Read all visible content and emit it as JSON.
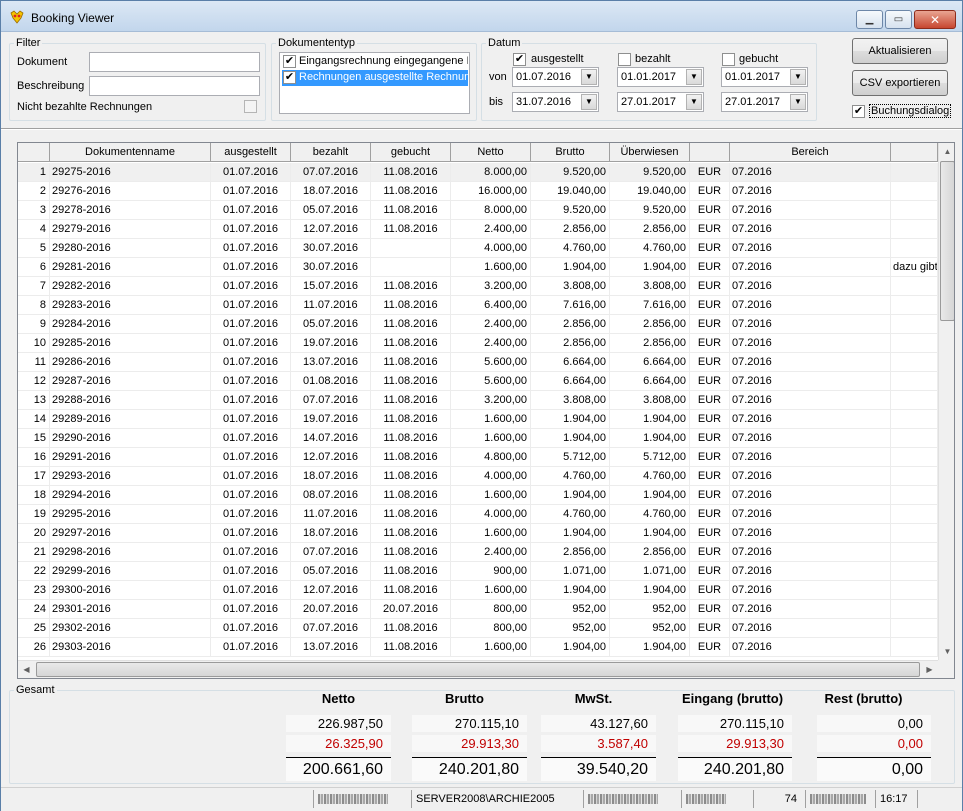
{
  "window": {
    "title": "Booking Viewer"
  },
  "filter": {
    "legend": "Filter",
    "dokument_label": "Dokument",
    "dokument_value": "",
    "beschreibung_label": "Beschreibung",
    "beschreibung_value": "",
    "unpaid_label": "Nicht bezahlte Rechnungen"
  },
  "doctype": {
    "legend": "Dokumententyp",
    "items": [
      {
        "label": "Eingangsrechnung eingegangene Re",
        "checked": true,
        "selected": false
      },
      {
        "label": "Rechnungen ausgestellte Rechnung",
        "checked": true,
        "selected": true
      }
    ]
  },
  "datum": {
    "legend": "Datum",
    "ausgestellt_label": "ausgestellt",
    "bezahlt_label": "bezahlt",
    "gebucht_label": "gebucht",
    "von_label": "von",
    "bis_label": "bis",
    "von": [
      "01.07.2016",
      "01.01.2017",
      "01.01.2017"
    ],
    "bis": [
      "31.07.2016",
      "27.01.2017",
      "27.01.2017"
    ]
  },
  "actions": {
    "aktualisieren": "Aktualisieren",
    "csv": "CSV exportieren",
    "buchungsdialog": "Buchungsdialog"
  },
  "table": {
    "columns": [
      "",
      "Dokumentenname",
      "ausgestellt",
      "bezahlt",
      "gebucht",
      "Netto",
      "Brutto",
      "Überwiesen",
      "",
      "Bereich"
    ],
    "rows": [
      [
        "1",
        "29275-2016",
        "01.07.2016",
        "07.07.2016",
        "11.08.2016",
        "8.000,00",
        "9.520,00",
        "9.520,00",
        "EUR",
        "07.2016",
        ""
      ],
      [
        "2",
        "29276-2016",
        "01.07.2016",
        "18.07.2016",
        "11.08.2016",
        "16.000,00",
        "19.040,00",
        "19.040,00",
        "EUR",
        "07.2016",
        ""
      ],
      [
        "3",
        "29278-2016",
        "01.07.2016",
        "05.07.2016",
        "11.08.2016",
        "8.000,00",
        "9.520,00",
        "9.520,00",
        "EUR",
        "07.2016",
        ""
      ],
      [
        "4",
        "29279-2016",
        "01.07.2016",
        "12.07.2016",
        "11.08.2016",
        "2.400,00",
        "2.856,00",
        "2.856,00",
        "EUR",
        "07.2016",
        ""
      ],
      [
        "5",
        "29280-2016",
        "01.07.2016",
        "30.07.2016",
        "",
        "4.000,00",
        "4.760,00",
        "4.760,00",
        "EUR",
        "07.2016",
        ""
      ],
      [
        "6",
        "29281-2016",
        "01.07.2016",
        "30.07.2016",
        "",
        "1.600,00",
        "1.904,00",
        "1.904,00",
        "EUR",
        "07.2016",
        "dazu gibt"
      ],
      [
        "7",
        "29282-2016",
        "01.07.2016",
        "15.07.2016",
        "11.08.2016",
        "3.200,00",
        "3.808,00",
        "3.808,00",
        "EUR",
        "07.2016",
        ""
      ],
      [
        "8",
        "29283-2016",
        "01.07.2016",
        "11.07.2016",
        "11.08.2016",
        "6.400,00",
        "7.616,00",
        "7.616,00",
        "EUR",
        "07.2016",
        ""
      ],
      [
        "9",
        "29284-2016",
        "01.07.2016",
        "05.07.2016",
        "11.08.2016",
        "2.400,00",
        "2.856,00",
        "2.856,00",
        "EUR",
        "07.2016",
        ""
      ],
      [
        "10",
        "29285-2016",
        "01.07.2016",
        "19.07.2016",
        "11.08.2016",
        "2.400,00",
        "2.856,00",
        "2.856,00",
        "EUR",
        "07.2016",
        ""
      ],
      [
        "11",
        "29286-2016",
        "01.07.2016",
        "13.07.2016",
        "11.08.2016",
        "5.600,00",
        "6.664,00",
        "6.664,00",
        "EUR",
        "07.2016",
        ""
      ],
      [
        "12",
        "29287-2016",
        "01.07.2016",
        "01.08.2016",
        "11.08.2016",
        "5.600,00",
        "6.664,00",
        "6.664,00",
        "EUR",
        "07.2016",
        ""
      ],
      [
        "13",
        "29288-2016",
        "01.07.2016",
        "07.07.2016",
        "11.08.2016",
        "3.200,00",
        "3.808,00",
        "3.808,00",
        "EUR",
        "07.2016",
        ""
      ],
      [
        "14",
        "29289-2016",
        "01.07.2016",
        "19.07.2016",
        "11.08.2016",
        "1.600,00",
        "1.904,00",
        "1.904,00",
        "EUR",
        "07.2016",
        ""
      ],
      [
        "15",
        "29290-2016",
        "01.07.2016",
        "14.07.2016",
        "11.08.2016",
        "1.600,00",
        "1.904,00",
        "1.904,00",
        "EUR",
        "07.2016",
        ""
      ],
      [
        "16",
        "29291-2016",
        "01.07.2016",
        "12.07.2016",
        "11.08.2016",
        "4.800,00",
        "5.712,00",
        "5.712,00",
        "EUR",
        "07.2016",
        ""
      ],
      [
        "17",
        "29293-2016",
        "01.07.2016",
        "18.07.2016",
        "11.08.2016",
        "4.000,00",
        "4.760,00",
        "4.760,00",
        "EUR",
        "07.2016",
        ""
      ],
      [
        "18",
        "29294-2016",
        "01.07.2016",
        "08.07.2016",
        "11.08.2016",
        "1.600,00",
        "1.904,00",
        "1.904,00",
        "EUR",
        "07.2016",
        ""
      ],
      [
        "19",
        "29295-2016",
        "01.07.2016",
        "11.07.2016",
        "11.08.2016",
        "4.000,00",
        "4.760,00",
        "4.760,00",
        "EUR",
        "07.2016",
        ""
      ],
      [
        "20",
        "29297-2016",
        "01.07.2016",
        "18.07.2016",
        "11.08.2016",
        "1.600,00",
        "1.904,00",
        "1.904,00",
        "EUR",
        "07.2016",
        ""
      ],
      [
        "21",
        "29298-2016",
        "01.07.2016",
        "07.07.2016",
        "11.08.2016",
        "2.400,00",
        "2.856,00",
        "2.856,00",
        "EUR",
        "07.2016",
        ""
      ],
      [
        "22",
        "29299-2016",
        "01.07.2016",
        "05.07.2016",
        "11.08.2016",
        "900,00",
        "1.071,00",
        "1.071,00",
        "EUR",
        "07.2016",
        ""
      ],
      [
        "23",
        "29300-2016",
        "01.07.2016",
        "12.07.2016",
        "11.08.2016",
        "1.600,00",
        "1.904,00",
        "1.904,00",
        "EUR",
        "07.2016",
        ""
      ],
      [
        "24",
        "29301-2016",
        "01.07.2016",
        "20.07.2016",
        "20.07.2016",
        "800,00",
        "952,00",
        "952,00",
        "EUR",
        "07.2016",
        ""
      ],
      [
        "25",
        "29302-2016",
        "01.07.2016",
        "07.07.2016",
        "11.08.2016",
        "800,00",
        "952,00",
        "952,00",
        "EUR",
        "07.2016",
        ""
      ],
      [
        "26",
        "29303-2016",
        "01.07.2016",
        "13.07.2016",
        "11.08.2016",
        "1.600,00",
        "1.904,00",
        "1.904,00",
        "EUR",
        "07.2016",
        ""
      ]
    ]
  },
  "gesamt": {
    "legend": "Gesamt",
    "headers": [
      "Netto",
      "Brutto",
      "MwSt.",
      "Eingang (brutto)",
      "Rest (brutto)"
    ],
    "line1": [
      "226.987,50",
      "270.115,10",
      "43.127,60",
      "270.115,10",
      "0,00"
    ],
    "line2": [
      "26.325,90",
      "29.913,30",
      "3.587,40",
      "29.913,30",
      "0,00"
    ],
    "total": [
      "200.661,60",
      "240.201,80",
      "39.540,20",
      "240.201,80",
      "0,00"
    ],
    "red_color": "#c00000"
  },
  "status": {
    "server": "SERVER2008\\ARCHIE2005",
    "count": "74",
    "time": "16:17"
  }
}
